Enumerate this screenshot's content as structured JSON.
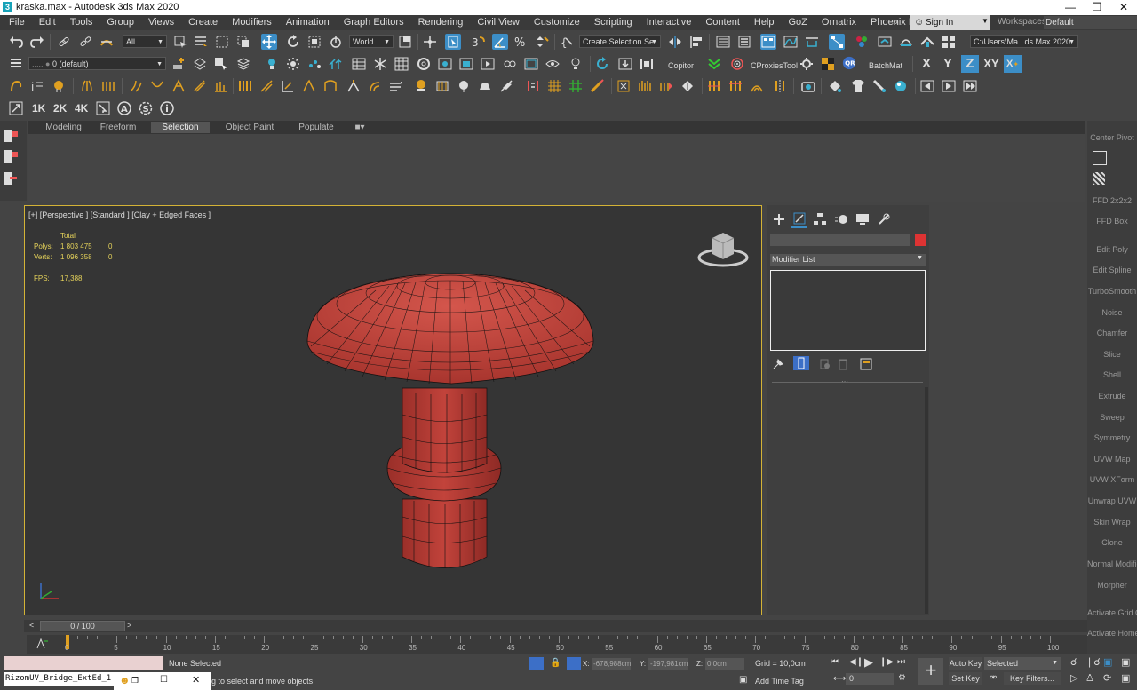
{
  "window": {
    "title": "kraska.max - Autodesk 3ds Max 2020"
  },
  "menu": [
    "File",
    "Edit",
    "Tools",
    "Group",
    "Views",
    "Create",
    "Modifiers",
    "Animation",
    "Graph Editors",
    "Rendering",
    "Civil View",
    "Customize",
    "Scripting",
    "Interactive",
    "Content",
    "Help",
    "GoZ",
    "Ornatrix",
    "Phoenix FD"
  ],
  "menu_overflow": "»",
  "signin": "Sign In",
  "workspaces_label": "Workspaces:",
  "workspaces_value": "Default",
  "toolbar1": {
    "selection_filter": "All",
    "ref_coord": "World",
    "named_selection": "Create Selection Se",
    "path": "C:\\Users\\Ma...ds Max 2020"
  },
  "toolbar2": {
    "layer": "0 (default)",
    "copitor": "Copitor",
    "cproxies": "CProxiesTool",
    "batchmat": "BatchMat",
    "axes": [
      "X",
      "Y",
      "Z",
      "XY"
    ]
  },
  "toolbar4": {
    "buttons": [
      "1K",
      "2K",
      "4K"
    ]
  },
  "ribbon": {
    "tabs": [
      "Modeling",
      "Freeform",
      "Selection",
      "Object Paint",
      "Populate"
    ],
    "active": "Selection"
  },
  "viewport": {
    "label": "[+] [Perspective ] [Standard ] [Clay + Edged Faces ]",
    "stats": {
      "total": "Total",
      "polys_label": "Polys:",
      "polys": "1 803 475",
      "polys_sel": "0",
      "verts_label": "Verts:",
      "verts": "1 096 358",
      "verts_sel": "0",
      "fps_label": "FPS:",
      "fps": "17,388"
    }
  },
  "command_panel": {
    "modifier_list": "Modifier List"
  },
  "right_column": [
    "Center Pivot",
    "FFD 2x2x2",
    "FFD Box",
    "Edit Poly",
    "Edit Spline",
    "TurboSmooth",
    "Noise",
    "Chamfer",
    "Slice",
    "Shell",
    "Extrude",
    "Sweep",
    "Symmetry",
    "UVW Map",
    "UVW XForm",
    "Unwrap UVW",
    "Skin Wrap",
    "Clone",
    "Normal Modifier",
    "Morpher",
    "Activate Grid Obj",
    "Activate Home G"
  ],
  "timeline": {
    "frame": "0 / 100",
    "ticks": [
      "0",
      "5",
      "10",
      "15",
      "20",
      "25",
      "30",
      "35",
      "40",
      "45",
      "50",
      "55",
      "60",
      "65",
      "70",
      "75",
      "80",
      "85",
      "90",
      "95",
      "100"
    ]
  },
  "status": {
    "script": "RizomUV_Bridge_ExtEd_1",
    "selection": "None Selected",
    "prompt": "g to select and move objects",
    "x_label": "X:",
    "x": "-678,988cm",
    "y_label": "Y:",
    "y": "-197,981cm",
    "z_label": "Z:",
    "z": "0,0cm",
    "grid": "Grid = 10,0cm",
    "add_time_tag": "Add Time Tag",
    "auto_key": "Auto Key",
    "set_key": "Set Key",
    "key_mode": "Selected",
    "key_filters": "Key Filters...",
    "frame_field": "0"
  },
  "colors": {
    "accent": "#3c8ec7",
    "viewport_border": "#d4b336",
    "mesh": "#c2433b",
    "stats": "#e5d25a"
  }
}
